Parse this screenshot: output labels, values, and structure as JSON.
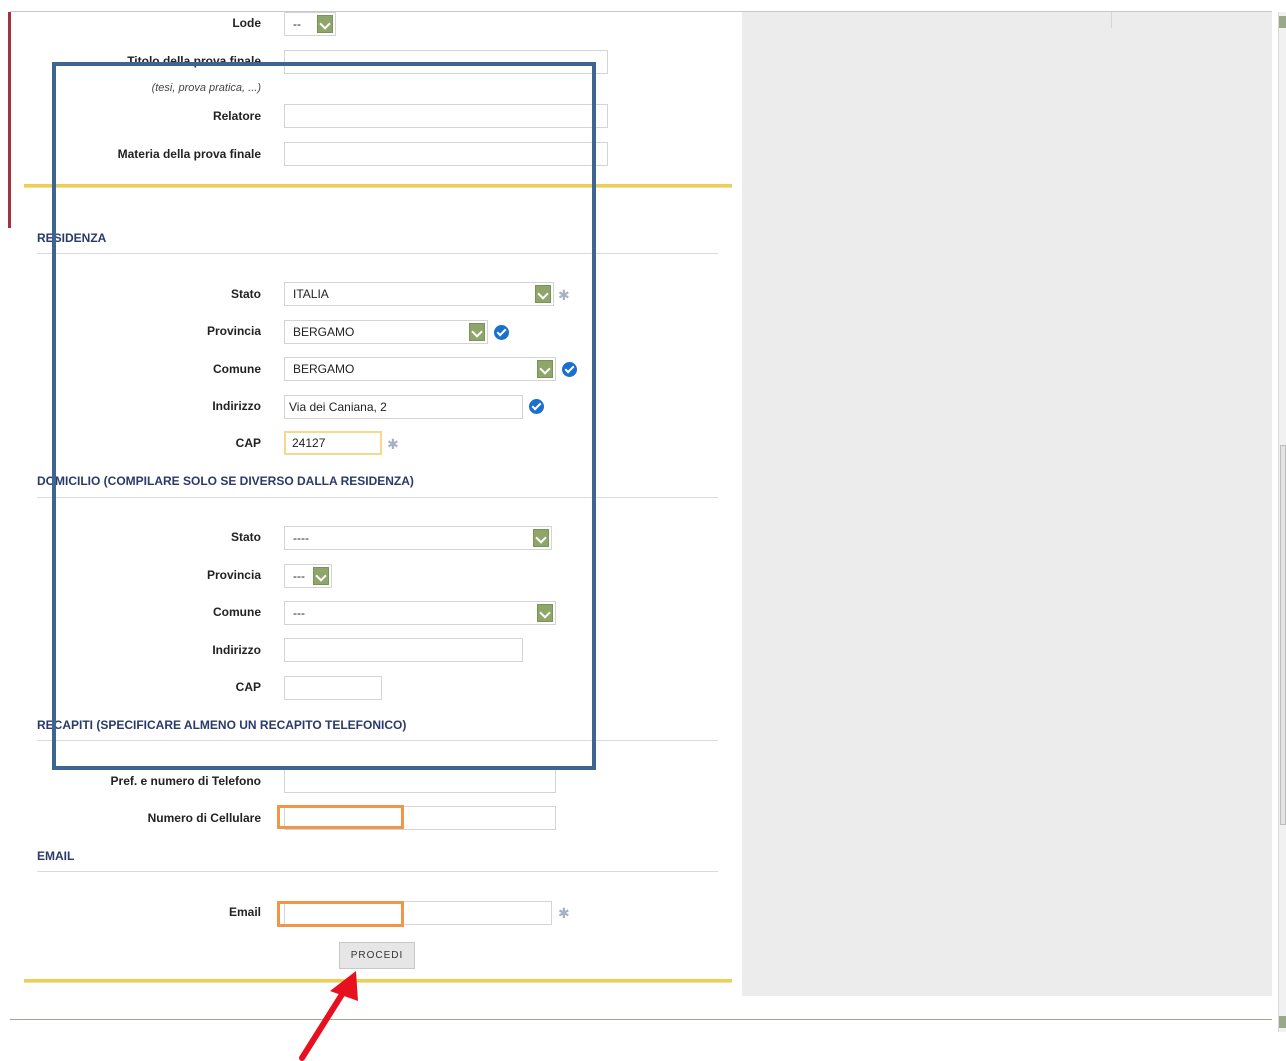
{
  "form": {
    "lode": {
      "label": "Lode",
      "value": "--"
    },
    "titolo": {
      "label": "Titolo della prova finale",
      "hint": "(tesi, prova pratica, ...)",
      "value": ""
    },
    "relatore": {
      "label": "Relatore",
      "value": ""
    },
    "materia": {
      "label": "Materia della prova finale",
      "value": ""
    }
  },
  "residenza": {
    "title": "RESIDENZA",
    "stato": {
      "label": "Stato",
      "value": "ITALIA"
    },
    "provincia": {
      "label": "Provincia",
      "value": "BERGAMO"
    },
    "comune": {
      "label": "Comune",
      "value": "BERGAMO"
    },
    "indirizzo": {
      "label": "Indirizzo",
      "value": "Via dei Caniana, 2"
    },
    "cap": {
      "label": "CAP",
      "value": "24127"
    }
  },
  "domicilio": {
    "title": "DOMICILIO (COMPILARE SOLO SE DIVERSO DALLA RESIDENZA)",
    "stato": {
      "label": "Stato",
      "value": "----"
    },
    "provincia": {
      "label": "Provincia",
      "value": "---"
    },
    "comune": {
      "label": "Comune",
      "value": "---"
    },
    "indirizzo": {
      "label": "Indirizzo",
      "value": ""
    },
    "cap": {
      "label": "CAP",
      "value": ""
    }
  },
  "recapiti": {
    "title": "RECAPITI (SPECIFICARE ALMENO UN RECAPITO TELEFONICO)",
    "telefono": {
      "label": "Pref. e numero di Telefono",
      "value": ""
    },
    "cellulare": {
      "label": "Numero di Cellulare",
      "value": ""
    }
  },
  "email": {
    "title": "EMAIL",
    "email": {
      "label": "Email",
      "value": ""
    }
  },
  "actions": {
    "procedi": "PROCEDI"
  },
  "icons": {
    "required": "asterisk-icon",
    "valid": "check-circle-icon",
    "dropdown": "chevron-down-icon"
  },
  "colors": {
    "dropdown_button": "#8fa66b",
    "check": "#1b6fcf",
    "section_title": "#2a3a6a",
    "gold_rule": "#f1cf4e",
    "annotation_blue": "#3e6591",
    "annotation_orange": "#f0954a",
    "annotation_red": "#e8101e"
  }
}
